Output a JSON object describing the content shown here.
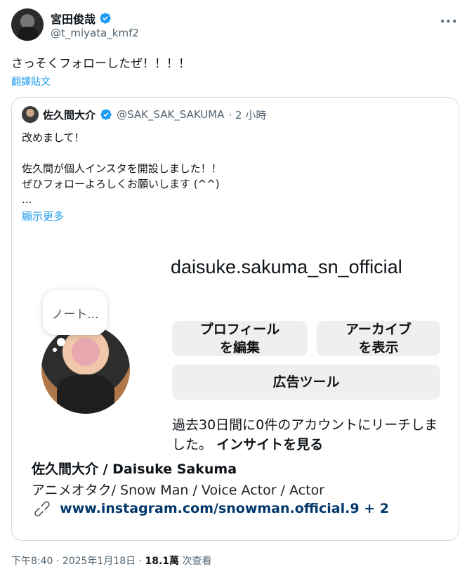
{
  "tweet": {
    "author_name": "宮田俊哉",
    "author_handle": "@t_miyata_kmf2",
    "text": "さっそくフォローしたぜ！！！！",
    "translate_label": "翻譯貼文",
    "more_icon": "more-dots-icon"
  },
  "quote": {
    "author_name": "佐久間大介",
    "author_handle": "@SAK_SAK_SAKUMA",
    "time": "· 2 小時",
    "lines": [
      "改めまして！",
      "",
      "佐久間が個人インスタを開設しました！！",
      "ぜひフォローよろしくお願いします (^^)",
      "..."
    ],
    "show_more": "顯示更多"
  },
  "instagram": {
    "username": "daisuke.sakuma_sn_official",
    "note": "ノート...",
    "edit_profile": "プロフィール\nを編集",
    "archive": "アーカイブ\nを表示",
    "ad_tools": "広告ツール",
    "reach_text": "過去30日間に0件のアカウントにリーチしました。",
    "insights": "インサイトを見る",
    "full_name": "佐久間大介 / Daisuke Sakuma",
    "bio": "アニメオタク/ Snow Man / Voice Actor / Actor",
    "link": "www.instagram.com/snowman.official.9 + 2"
  },
  "meta": {
    "time": "下午8:40 · 2025年1月18日 · ",
    "views": "18.1萬",
    "views_label": " 次查看"
  },
  "colors": {
    "accent": "#1d9bf0",
    "link": "#00376b",
    "muted": "#536471"
  }
}
